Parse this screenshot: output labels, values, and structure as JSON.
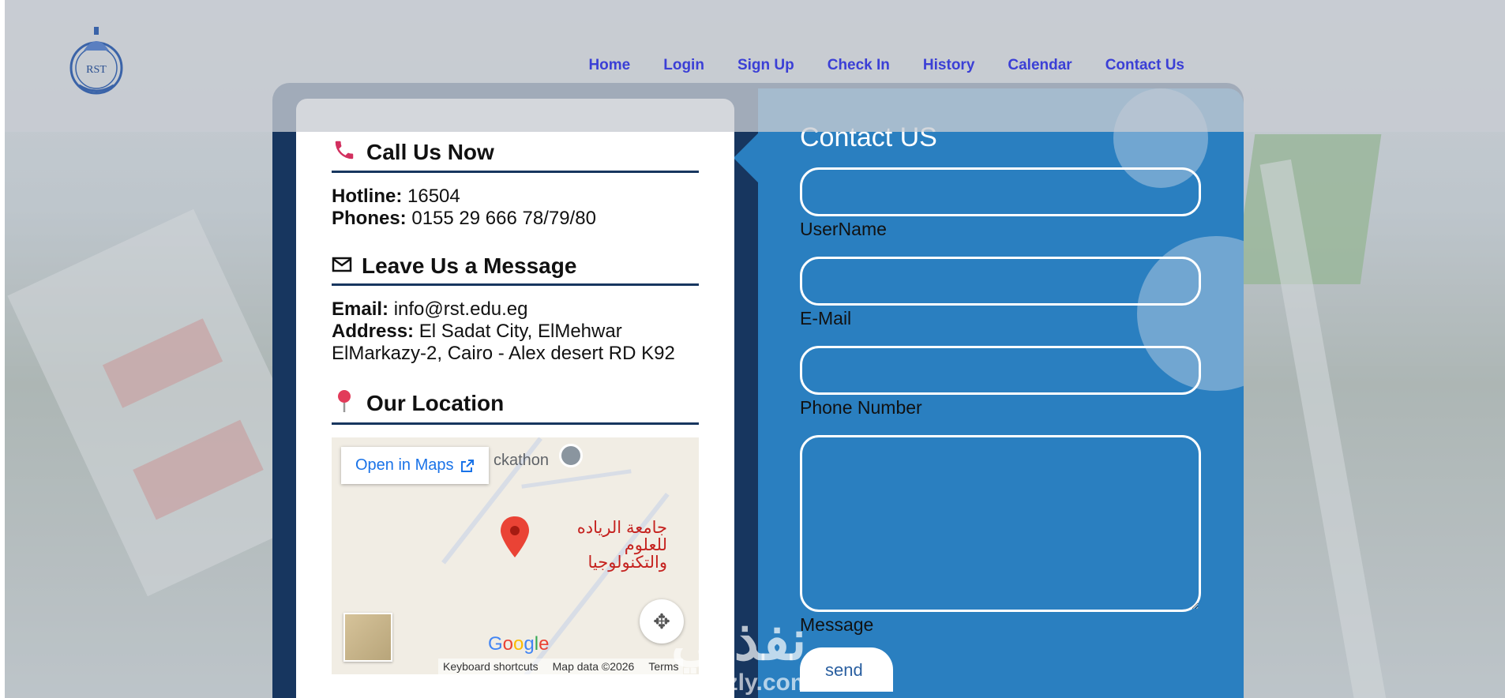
{
  "header": {
    "logo_text": "RST",
    "nav": [
      "Home",
      "Login",
      "Sign Up",
      "Check In",
      "History",
      "Calendar",
      "Contact Us"
    ]
  },
  "call": {
    "title": "Call Us Now",
    "hotline_label": "Hotline:",
    "hotline": "16504",
    "phones_label": "Phones:",
    "phones": "0155 29 666 78/79/80"
  },
  "message": {
    "title": "Leave Us a Message",
    "email_label": "Email:",
    "email": "info@rst.edu.eg",
    "address_label": "Address:",
    "address": "El Sadat City, ElMehwar ElMarkazy-2, Cairo - Alex desert RD K92"
  },
  "location": {
    "title": "Our Location",
    "open_maps": "Open in Maps",
    "place_top": "ckathon",
    "place_ar_line1": "جامعة الرياده للعلوم",
    "place_ar_line2": "والتكنولوجيا",
    "google": "Google",
    "footer": [
      "Keyboard shortcuts",
      "Map data ©2026",
      "Terms"
    ]
  },
  "form": {
    "title": "Contact US",
    "username_label": "UserName",
    "email_label": "E-Mail",
    "phone_label": "Phone Number",
    "message_label": "Message",
    "send_label": "send"
  },
  "watermark": {
    "main": "نفذلي",
    "sub": "nafezly.com"
  },
  "colors": {
    "nav": "#3b3fd6",
    "panel_blue": "#2a7fc0",
    "dark_navy": "#17365f",
    "pin_red": "#ea4335"
  }
}
